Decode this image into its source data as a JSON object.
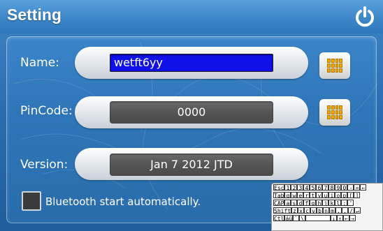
{
  "window": {
    "title": "Setting"
  },
  "fields": {
    "name_label": "Name:",
    "name_value": "wetft6yy",
    "pincode_label": "PinCode:",
    "pincode_value": "0000",
    "version_label": "Version:",
    "version_value": "Jan  7 2012 JTD"
  },
  "bluetooth": {
    "label": "Bluetooth start automatically.",
    "checked": false
  },
  "icons": {
    "power": "power-icon",
    "keyboard": "keyboard-grid-icon"
  },
  "colors": {
    "background": "#2a6fb2",
    "name_field": "#1010e8",
    "keyboard_icon": "#f0a900"
  },
  "osk": {
    "rows": [
      [
        "Esc",
        "1",
        "2",
        "3",
        "4",
        "5",
        "6",
        "7",
        "8",
        "9",
        "0",
        "-",
        "=",
        "←"
      ],
      [
        "Tab",
        "q",
        "w",
        "e",
        "r",
        "t",
        "y",
        "u",
        "i",
        "o",
        "p",
        "[",
        "]"
      ],
      [
        "CAP",
        "a",
        "s",
        "d",
        "f",
        "g",
        "h",
        "j",
        "k",
        "l",
        ";",
        "'"
      ],
      [
        "Shift",
        "z",
        "x",
        "c",
        "v",
        "b",
        "n",
        "m",
        ",",
        ".",
        "/",
        "↵"
      ],
      [
        "Ctl",
        "áü",
        "`",
        "\\",
        "",
        "",
        "",
        "",
        "↓",
        "↑",
        "←",
        "→"
      ]
    ]
  }
}
